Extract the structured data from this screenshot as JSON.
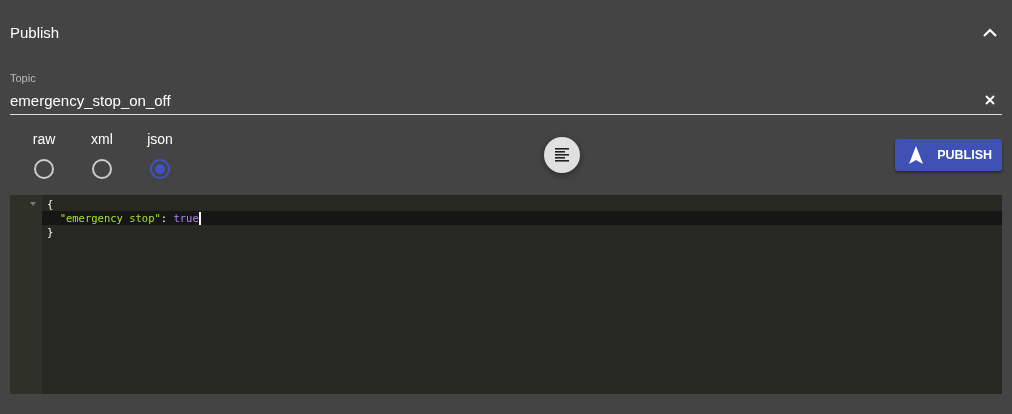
{
  "panel": {
    "title": "Publish",
    "expanded": true
  },
  "topic": {
    "label": "Topic",
    "value": "emergency_stop_on_off"
  },
  "formats": [
    {
      "label": "raw",
      "selected": false
    },
    {
      "label": "xml",
      "selected": false
    },
    {
      "label": "json",
      "selected": true
    }
  ],
  "publish_button": {
    "label": "PUBLISH"
  },
  "editor": {
    "lines": [
      {
        "foldable": true,
        "active": false,
        "tokens": [
          {
            "kind": "punct",
            "text": "{"
          }
        ]
      },
      {
        "active": true,
        "cursor": true,
        "tokens": [
          {
            "kind": "string",
            "text": "  \"emergency stop\""
          },
          {
            "kind": "punct",
            "text": ": "
          },
          {
            "kind": "bool",
            "text": "true"
          }
        ]
      },
      {
        "active": false,
        "tokens": [
          {
            "kind": "punct",
            "text": "}"
          }
        ]
      }
    ]
  }
}
